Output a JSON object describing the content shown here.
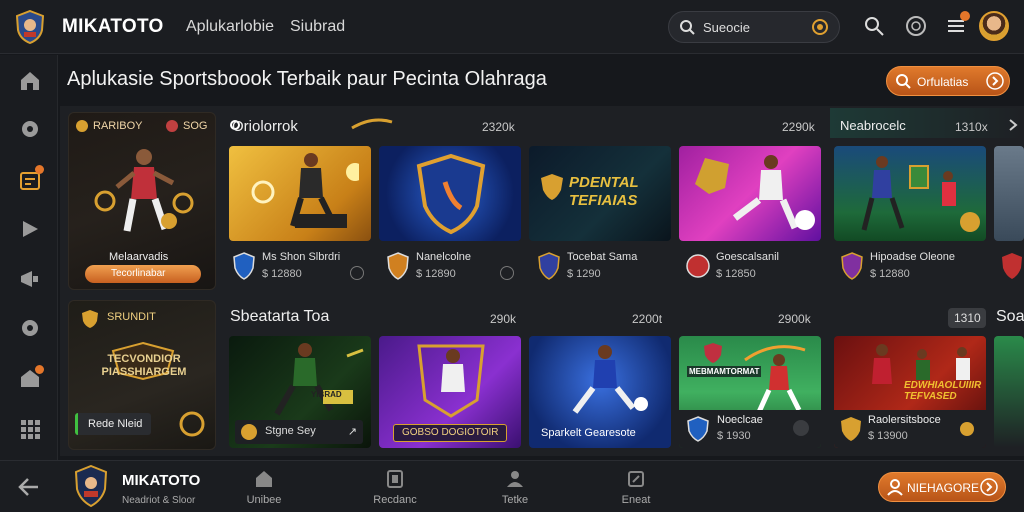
{
  "header": {
    "brand": "MIKATOTO",
    "nav": [
      "Aplukarlobie",
      "Siubrad"
    ],
    "search_text": "Sueocie"
  },
  "page": {
    "title": "Aplukasie Sportsboook Terbaik paur Pecinta Olahraga",
    "top_pill": "Orfulatias"
  },
  "featured": {
    "header_left": "RARIBOY",
    "header_right": "SOG",
    "name": "Melaarvadis",
    "button": "Tecorlinabar",
    "second_label": "SRUNDIT",
    "second_banner": "TECVONDIOR PIASSHIARGEM",
    "second_button": "Rede Nleid"
  },
  "row1": {
    "title": "Oriolorrok",
    "meta": "2320k",
    "meta2": "2290k",
    "title2": "Neabrocelc",
    "meta3": "1310x",
    "cards": [
      {
        "name": "Ms Shon Slbrdri",
        "sub": "$ 12880",
        "theme": "gold"
      },
      {
        "name": "Nanelcolne",
        "sub": "$ 12890",
        "theme": "blue"
      },
      {
        "name": "Tocebat Sama",
        "sub": "$ 1290",
        "theme": "dark",
        "overlay": "PDENTAL TEFIAIAS"
      },
      {
        "name": "Goescalsanil",
        "sub": "$ 12850",
        "theme": "purple"
      },
      {
        "name": "Hipoadse Oleone",
        "sub": "$ 12880",
        "theme": "stadium"
      }
    ]
  },
  "row2": {
    "title": "Sbeatarta Toa",
    "meta": "290k",
    "meta2": "2200t",
    "meta3": "2900k",
    "meta4": "1310",
    "title2": "Soa",
    "cards": [
      {
        "name": "Stgne Sey",
        "theme": "darkgreen",
        "overlay": "YIBRAD"
      },
      {
        "name": "GOBSO DOGIOTOIR",
        "theme": "purple2"
      },
      {
        "name": "Sparkelt Gearesote",
        "theme": "blue2"
      },
      {
        "name": "Noeclcae",
        "sub": "$ 1930",
        "theme": "green",
        "overlay": "MEBMAMTORMAT"
      },
      {
        "name": "Raolersitsboce",
        "sub": "$ 13900",
        "theme": "red",
        "overlay": "EDWHIAOLUIIIR TEFVASED"
      }
    ]
  },
  "bottom": {
    "brand": "MIKATOTO",
    "tagline": "Neadriot & Sloor",
    "tabs": [
      "Unibee",
      "Recdanc",
      "Tetke",
      "Eneat"
    ],
    "pill": "NIEHAGORE"
  },
  "colors": {
    "accent": "#e4762a",
    "background": "#16181c",
    "panel": "#1e2024"
  }
}
